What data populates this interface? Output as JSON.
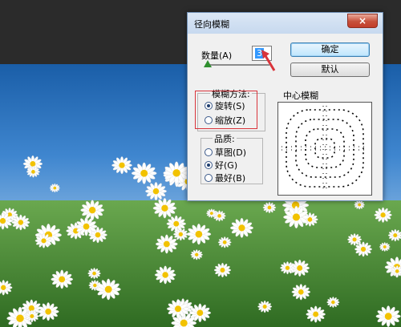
{
  "dialog": {
    "title": "径向模糊",
    "close_label": "×",
    "amount": {
      "label": "数量(A)",
      "value": "3",
      "slider_fraction": 0.03
    },
    "ok_label": "确定",
    "default_label": "默认",
    "method": {
      "legend": "模糊方法:",
      "options": [
        {
          "label": "旋转(S)",
          "checked": true
        },
        {
          "label": "缩放(Z)",
          "checked": false
        }
      ]
    },
    "quality": {
      "legend": "品质:",
      "options": [
        {
          "label": "草图(D)",
          "checked": false
        },
        {
          "label": "好(G)",
          "checked": true
        },
        {
          "label": "最好(B)",
          "checked": false
        }
      ]
    },
    "center_label": "中心模糊"
  },
  "colors": {
    "highlight": "#d9343b",
    "arrow": "#d9343b",
    "slider_thumb": "#2f8f2f",
    "selection": "#3399ff"
  },
  "icons": [
    "close-icon",
    "red-arrow-icon",
    "slider-thumb-icon"
  ]
}
